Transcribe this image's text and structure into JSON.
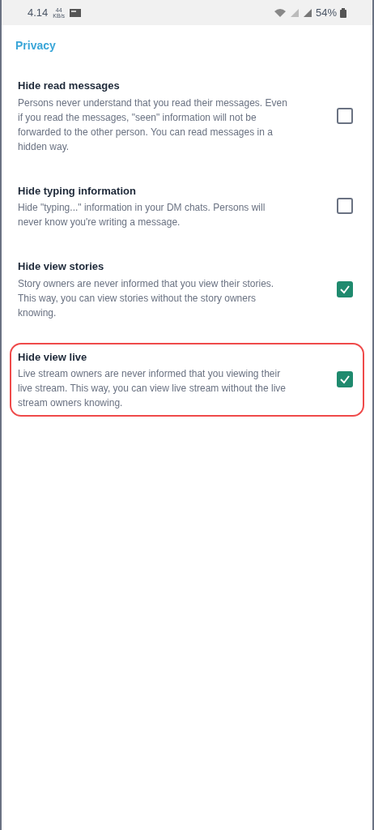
{
  "status_bar": {
    "time": "4.14",
    "net_speed": "44",
    "net_unit": "KB/s",
    "battery": "54%"
  },
  "section_title": "Privacy",
  "items": [
    {
      "title": "Hide read messages",
      "description": "Persons never understand that you read their messages. Even if you read the messages, \"seen\" information will not be forwarded to the other person. You can read messages in a hidden way.",
      "checked": false,
      "highlighted": false
    },
    {
      "title": "Hide typing information",
      "description": "Hide \"typing...\" information in your DM chats. Persons will never know you're writing a message.",
      "checked": false,
      "highlighted": false
    },
    {
      "title": "Hide view stories",
      "description": "Story owners are never informed that you view their stories. This way, you can view stories without the story owners knowing.",
      "checked": true,
      "highlighted": false
    },
    {
      "title": "Hide view live",
      "description": "Live stream owners are never informed that you viewing their live stream. This way, you can view live stream without the live stream owners knowing.",
      "checked": true,
      "highlighted": true
    }
  ]
}
